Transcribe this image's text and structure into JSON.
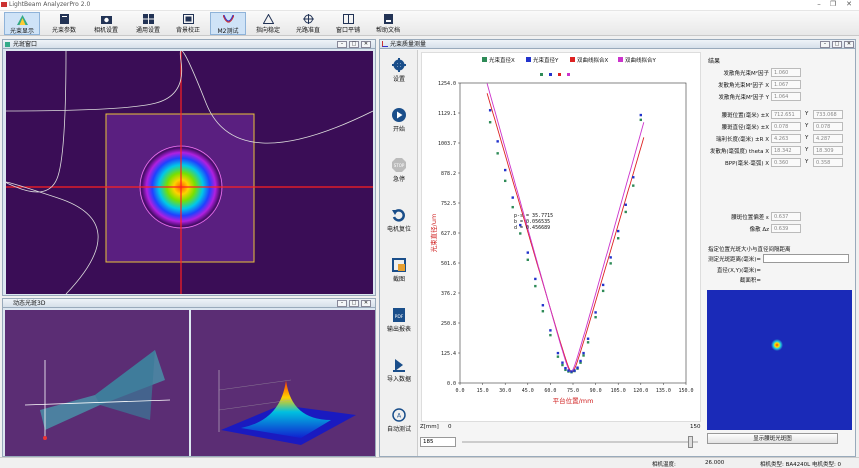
{
  "app": {
    "title": "LightBeam AnalyzerPro 2.0"
  },
  "toolbar": {
    "items": [
      {
        "label": "光束显示",
        "icon": "beam-display-icon"
      },
      {
        "label": "光束参数",
        "icon": "beam-params-icon"
      },
      {
        "label": "相机设置",
        "icon": "camera-icon"
      },
      {
        "label": "通用设置",
        "icon": "grid-settings-icon"
      },
      {
        "label": "背景校正",
        "icon": "background-correct-icon"
      },
      {
        "label": "M2测试",
        "icon": "m2-test-icon"
      },
      {
        "label": "指向稳定",
        "icon": "pointing-icon"
      },
      {
        "label": "光路准直",
        "icon": "collimation-icon"
      },
      {
        "label": "窗口平铺",
        "icon": "tile-window-icon"
      },
      {
        "label": "帮助文档",
        "icon": "help-doc-icon"
      }
    ]
  },
  "panels": {
    "beam_window": "光斑窗口",
    "dynamic_3d": "动态光斑3D",
    "m2_window": "光束质量测量"
  },
  "m2_buttons": [
    {
      "label": "设置",
      "icon": "gear-icon"
    },
    {
      "label": "开始",
      "icon": "play-icon"
    },
    {
      "label": "急停",
      "icon": "stop-icon"
    },
    {
      "label": "电机复位",
      "icon": "reset-icon"
    },
    {
      "label": "截图",
      "icon": "screenshot-icon"
    },
    {
      "label": "输出报表",
      "icon": "pdf-icon"
    },
    {
      "label": "导入数据",
      "icon": "import-icon"
    },
    {
      "label": "自动测试",
      "icon": "auto-test-icon"
    }
  ],
  "results": {
    "heading": "结果",
    "rows1": [
      {
        "label": "发散角光束M²因子",
        "value": "1.060"
      },
      {
        "label": "发散角光束M²因子 X",
        "value": "1.067"
      },
      {
        "label": "发散角光束M²因子 Y",
        "value": "1.064"
      }
    ],
    "rows2": [
      {
        "label": "腰斑位置(毫米) ±X",
        "vx": "712.651",
        "vy": "733.068"
      },
      {
        "label": "腰斑直径(毫米) ±X",
        "vx": "0.078",
        "vy": "0.078"
      },
      {
        "label": "瑞利长度(毫米) ±R X",
        "vx": "4.263",
        "vy": "4.287"
      },
      {
        "label": "发散角(毫弧度) theta X",
        "vx": "18.342",
        "vy": "18.309"
      },
      {
        "label": "BPP(毫米·毫弧) X",
        "vx": "0.360",
        "vy": "0.358"
      }
    ],
    "rows3": [
      {
        "label": "腰斑位置偏差 ε",
        "value": "0.637"
      },
      {
        "label": "像散 Δz",
        "value": "0.639"
      }
    ],
    "calc_title": "指定位置光斑大小与直径间隔距离",
    "calc_dist_label": "测定光斑距离(毫米)=",
    "calc_diam_label": "直径(X,Y)(毫米)=",
    "calc_area_label": "截面积=",
    "show_button": "显示腰斑光斑图"
  },
  "plot": {
    "z_label": "Z[mm]",
    "z_min": "0",
    "z_max": "150",
    "z_input": "185",
    "annotation": [
      "p-s = 35.7715",
      "b = 0.056535",
      "d = 0.456689"
    ]
  },
  "chart_data": {
    "type": "scatter",
    "title": "",
    "xlabel": "平台位置/mm",
    "ylabel": "光束直径/um",
    "xlim": [
      0,
      150
    ],
    "ylim": [
      0,
      1254.0
    ],
    "x_ticks": [
      "0.0",
      "15.0",
      "30.0",
      "45.0",
      "60.0",
      "75.0",
      "90.0",
      "105.0",
      "120.0",
      "135.0",
      "150.0"
    ],
    "y_ticks": [
      "0.0",
      "125.4",
      "250.8",
      "376.2",
      "501.6",
      "627.0",
      "752.5",
      "878.2",
      "1003.7",
      "1129.1",
      "1254.0"
    ],
    "legend": [
      {
        "name": "光束直径X",
        "color": "#2e8b57"
      },
      {
        "name": "光束直径Y",
        "color": "#2233cc"
      },
      {
        "name": "双曲线拟合X",
        "color": "#dd2222"
      },
      {
        "name": "双曲线拟合Y",
        "color": "#cc33cc"
      }
    ],
    "series": [
      {
        "name": "光束直径X",
        "x": [
          20,
          25,
          30,
          35,
          40,
          45,
          50,
          55,
          60,
          65,
          68,
          70,
          72,
          74,
          76,
          78,
          80,
          82,
          85,
          90,
          95,
          100,
          105,
          110,
          115,
          120
        ],
        "y": [
          1090,
          960,
          845,
          735,
          625,
          515,
          405,
          300,
          200,
          110,
          75,
          55,
          48,
          45,
          50,
          60,
          85,
          115,
          170,
          275,
          385,
          500,
          605,
          715,
          825,
          1100
        ]
      },
      {
        "name": "光束直径Y",
        "x": [
          20,
          25,
          30,
          35,
          40,
          45,
          50,
          55,
          60,
          65,
          68,
          70,
          72,
          74,
          76,
          78,
          80,
          82,
          85,
          90,
          95,
          100,
          105,
          110,
          115,
          120
        ],
        "y": [
          1140,
          1010,
          890,
          775,
          660,
          545,
          435,
          325,
          220,
          125,
          85,
          62,
          52,
          48,
          52,
          64,
          92,
          125,
          185,
          295,
          410,
          525,
          635,
          745,
          860,
          1120
        ]
      }
    ],
    "fits": [
      {
        "name": "双曲线拟合X",
        "color": "#dd2222",
        "z0": 74.3,
        "d0": 45,
        "theta": 21.5
      },
      {
        "name": "双曲线拟合Y",
        "color": "#cc33cc",
        "z0": 73.6,
        "d0": 47,
        "theta": 22.5
      }
    ]
  },
  "status": {
    "temp_label": "相机温度:",
    "temp_value": "26.000",
    "camera_label": "相机类型: BA4240L 电机类型: 0"
  }
}
